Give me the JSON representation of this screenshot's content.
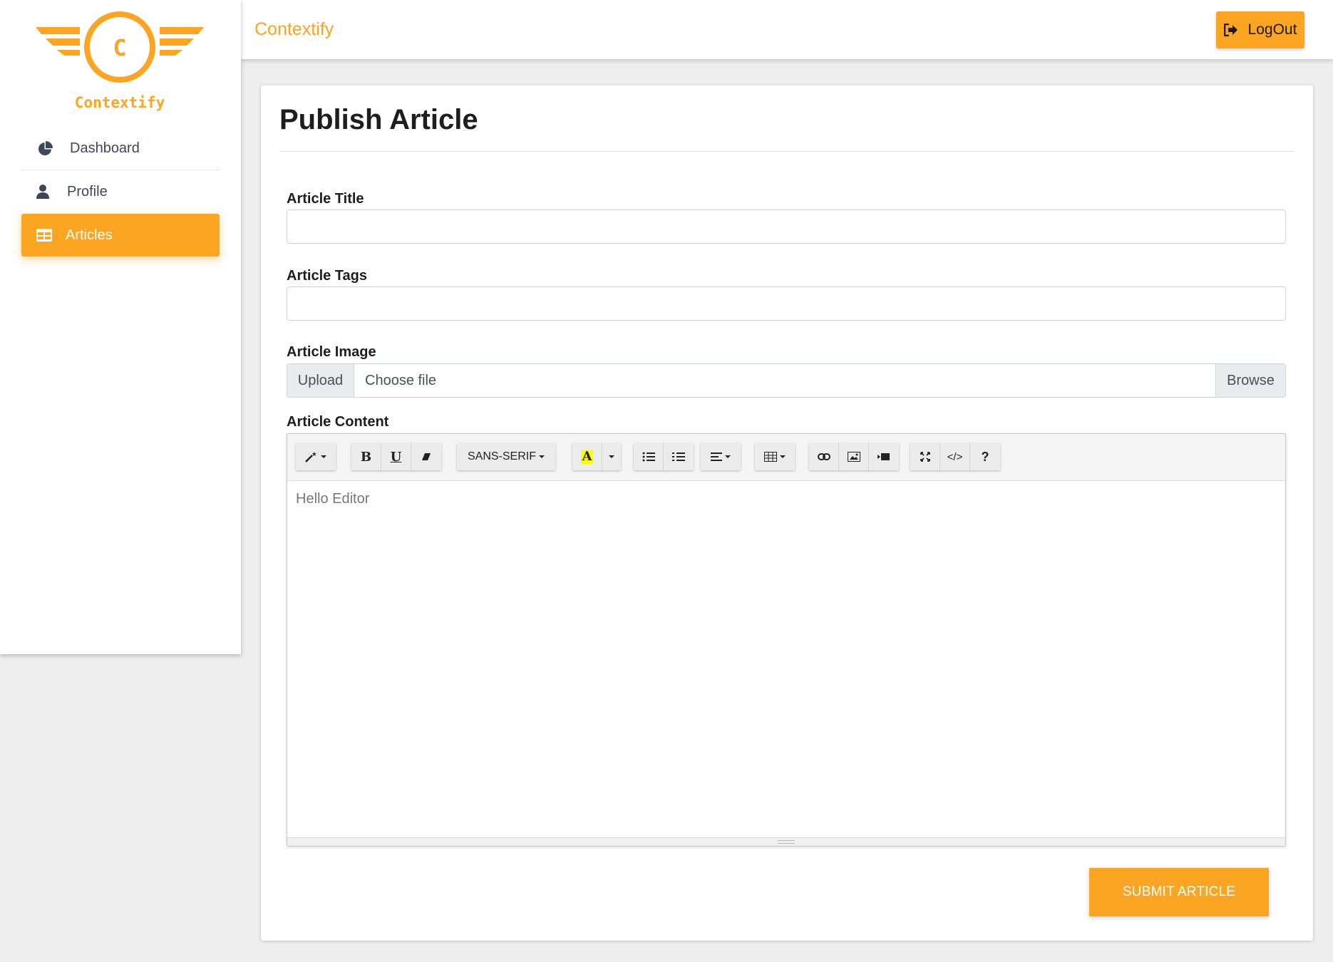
{
  "app": {
    "brand": "Contextify",
    "logo_text": "Contextify",
    "logo_letter": "C",
    "accent": "#fca522"
  },
  "sidebar": {
    "items": [
      {
        "label": "Dashboard",
        "icon": "pie-chart-icon",
        "active": false
      },
      {
        "label": "Profile",
        "icon": "user-icon",
        "active": false
      },
      {
        "label": "Articles",
        "icon": "table-icon",
        "active": true
      }
    ]
  },
  "topbar": {
    "title": "Contextify",
    "logout_label": "LogOut"
  },
  "form": {
    "heading": "Publish Article",
    "title_label": "Article Title",
    "title_value": "",
    "tags_label": "Article Tags",
    "tags_value": "",
    "image_label": "Article Image",
    "upload_label": "Upload",
    "choose_label": "Choose file",
    "browse_label": "Browse",
    "content_label": "Article Content",
    "editor": {
      "font_family": "SANS-SERIF",
      "content": "Hello Editor",
      "toolbar_icons": [
        "magic-style-icon",
        "bold-icon",
        "underline-icon",
        "eraser-icon",
        "font-family-dropdown",
        "text-color-icon",
        "color-dropdown-icon",
        "unordered-list-icon",
        "ordered-list-icon",
        "align-icon",
        "table-icon",
        "link-icon",
        "picture-icon",
        "video-icon",
        "fullscreen-icon",
        "code-view-icon",
        "help-icon"
      ]
    },
    "submit_label": "SUBMIT ARTICLE"
  }
}
